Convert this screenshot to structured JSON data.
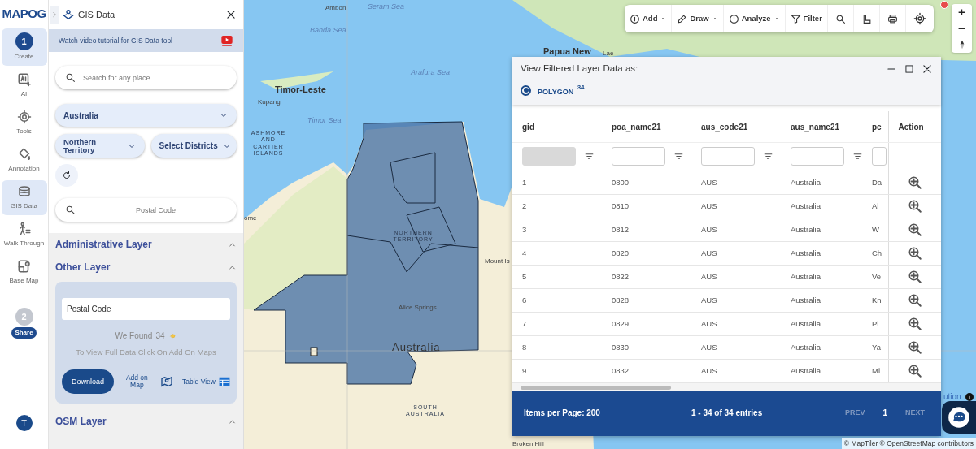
{
  "logo": "MAPOG",
  "rail": [
    {
      "kind": "step",
      "step": "1",
      "label": "Create",
      "selected": true
    },
    {
      "kind": "tool",
      "label": "AI",
      "selected": false
    },
    {
      "kind": "tool",
      "label": "Tools",
      "selected": false
    },
    {
      "kind": "tool",
      "label": "Annotation",
      "selected": false
    },
    {
      "kind": "tool",
      "label": "GIS Data",
      "selected": true
    },
    {
      "kind": "tool",
      "label": "Walk Through",
      "selected": false
    },
    {
      "kind": "tool",
      "label": "Base Map",
      "selected": false
    },
    {
      "kind": "step",
      "step": "2",
      "label": "Share",
      "selected": false
    }
  ],
  "user_avatar": "T",
  "panel": {
    "title": "GIS Data",
    "banner": "Watch video tutorial for GIS Data tool",
    "place_search": {
      "placeholder": "Search for any place"
    },
    "country": {
      "value": "Australia"
    },
    "state": {
      "value": "Northern Territory"
    },
    "district": {
      "placeholder": "Select Districts"
    },
    "postal_search": {
      "placeholder": "Postal Code"
    },
    "sections": [
      {
        "title": "Administrative Layer"
      },
      {
        "title": "Other Layer",
        "card": {
          "layer_input": {
            "value": "Postal Code"
          },
          "found_label": "We Found",
          "found_count": "34",
          "hint": "To View Full Data Click On Add On Maps",
          "download": "Download",
          "add_on_map": "Add on Map",
          "table_view": "Table View"
        }
      },
      {
        "title": "OSM Layer"
      }
    ]
  },
  "toolbar": [
    {
      "kind": "menu",
      "label": "Add"
    },
    {
      "kind": "menu",
      "label": "Draw"
    },
    {
      "kind": "menu",
      "label": "Analyze"
    },
    {
      "kind": "button",
      "label": "Filter"
    },
    {
      "kind": "search"
    },
    {
      "kind": "measure"
    },
    {
      "kind": "print"
    },
    {
      "kind": "locate"
    }
  ],
  "zoom_buttons": [
    "+",
    "−"
  ],
  "map_labels": [
    {
      "text": "Ambon",
      "kind": "place"
    },
    {
      "text": "Seram Sea",
      "kind": "sea"
    },
    {
      "text": "Banda Sea",
      "kind": "sea"
    },
    {
      "text": "Arafura Sea",
      "kind": "sea"
    },
    {
      "text": "Timor-Leste",
      "kind": "country"
    },
    {
      "text": "Kupang",
      "kind": "place"
    },
    {
      "text": "Timor Sea",
      "kind": "sea"
    },
    {
      "text": "ASHMORE AND CARTIER ISLANDS",
      "kind": "region"
    },
    {
      "text": "ome",
      "kind": "place"
    },
    {
      "text": "NORTHERN TERRITORY",
      "kind": "region"
    },
    {
      "text": "Mount Is",
      "kind": "place"
    },
    {
      "text": "Alice Springs",
      "kind": "place"
    },
    {
      "text": "Australia",
      "kind": "continent"
    },
    {
      "text": "SOUTH AUSTRALIA",
      "kind": "region"
    },
    {
      "text": "Broken Hill",
      "kind": "place"
    },
    {
      "text": "Papua New",
      "kind": "country"
    },
    {
      "text": "Lae",
      "kind": "place"
    }
  ],
  "attribution_partial": "ution",
  "attribution": "© MapTiler © OpenStreetMap contributors",
  "table_panel": {
    "title": "View Filtered Layer Data as:",
    "geometry_options": [
      {
        "label": "POLYGON",
        "count": "34",
        "selected": true
      }
    ],
    "columns": [
      "gid",
      "poa_name21",
      "aus_code21",
      "aus_name21",
      "pc",
      "Action"
    ],
    "filters": [
      {
        "disabled": true
      },
      {
        "disabled": false
      },
      {
        "disabled": false
      },
      {
        "disabled": false
      },
      {
        "disabled": false
      }
    ],
    "rows": [
      [
        "1",
        "0800",
        "AUS",
        "Australia",
        "Da"
      ],
      [
        "2",
        "0810",
        "AUS",
        "Australia",
        "Al"
      ],
      [
        "3",
        "0812",
        "AUS",
        "Australia",
        "W"
      ],
      [
        "4",
        "0820",
        "AUS",
        "Australia",
        "Ch"
      ],
      [
        "5",
        "0822",
        "AUS",
        "Australia",
        "Ve"
      ],
      [
        "6",
        "0828",
        "AUS",
        "Australia",
        "Kn"
      ],
      [
        "7",
        "0829",
        "AUS",
        "Australia",
        "Pi"
      ],
      [
        "8",
        "0830",
        "AUS",
        "Australia",
        "Ya"
      ],
      [
        "9",
        "0832",
        "AUS",
        "Australia",
        "Mi"
      ]
    ],
    "footer": {
      "items_per_page": "Items per Page: 200",
      "range": "1 - 34 of 34 entries",
      "prev": {
        "label": "PREV",
        "disabled": true
      },
      "page": "1",
      "next": {
        "label": "NEXT",
        "disabled": true
      }
    }
  }
}
